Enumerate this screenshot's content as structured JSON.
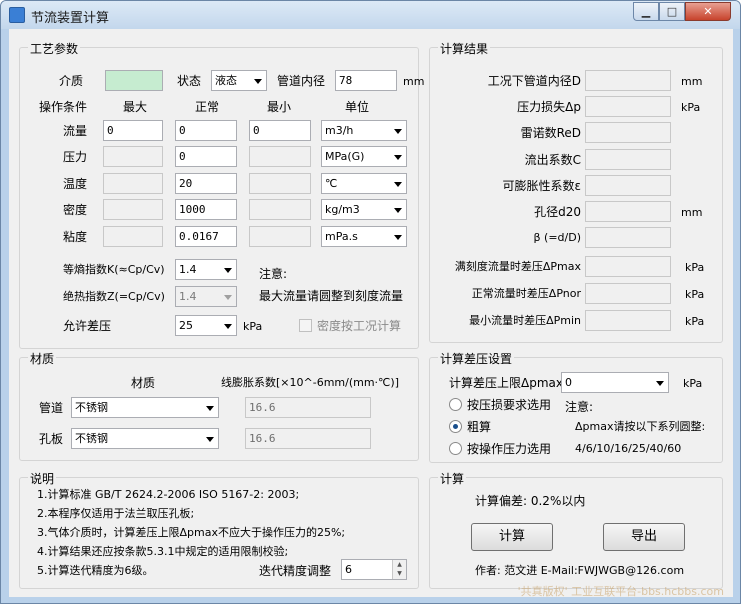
{
  "window": {
    "title": "节流装置计算",
    "min": "▁",
    "max": "□",
    "close": "✕"
  },
  "process": {
    "title": "工艺参数",
    "medium_label": "介质",
    "state_label": "状态",
    "state_value": "液态",
    "pipe_dia_label": "管道内径",
    "pipe_dia_value": "78",
    "pipe_dia_unit": "mm",
    "headers": {
      "cond": "操作条件",
      "max": "最大",
      "normal": "正常",
      "min": "最小",
      "unit": "单位"
    },
    "rows": [
      {
        "label": "流量",
        "max": "0",
        "normal": "0",
        "min": "0",
        "unit": "m3/h"
      },
      {
        "label": "压力",
        "max": "",
        "normal": "0",
        "min": "",
        "unit": "MPa(G)"
      },
      {
        "label": "温度",
        "max": "",
        "normal": "20",
        "min": "",
        "unit": "℃"
      },
      {
        "label": "密度",
        "max": "",
        "normal": "1000",
        "min": "",
        "unit": "kg/m3"
      },
      {
        "label": "粘度",
        "max": "",
        "normal": "0.0167",
        "min": "",
        "unit": "mPa.s"
      }
    ],
    "isen_label": "等熵指数K(≈Cp/Cv)",
    "isen_value": "1.4",
    "adiab_label": "绝热指数Z(=Cp/Cv)",
    "adiab_value": "1.4",
    "allow_label": "允许差压",
    "allow_value": "25",
    "allow_unit": "kPa",
    "note_title": "注意:",
    "note_text": "最大流量请圆整到刻度流量",
    "density_chk": "密度按工况计算"
  },
  "results": {
    "title": "计算结果",
    "rows": [
      {
        "label": "工况下管道内径D",
        "unit": "mm"
      },
      {
        "label": "压力损失Δp",
        "unit": "kPa"
      },
      {
        "label": "雷诺数ReD",
        "unit": ""
      },
      {
        "label": "流出系数C",
        "unit": ""
      },
      {
        "label": "可膨胀性系数ε",
        "unit": ""
      },
      {
        "label": "孔径d20",
        "unit": "mm"
      },
      {
        "label": "β (=d/D)",
        "unit": ""
      },
      {
        "label": "满刻度流量时差压ΔPmax",
        "unit": "kPa"
      },
      {
        "label": "正常流量时差压ΔPnor",
        "unit": "kPa"
      },
      {
        "label": "最小流量时差压ΔPmin",
        "unit": "kPa"
      }
    ]
  },
  "material": {
    "title": "材质",
    "col_mat": "材质",
    "col_coef": "线膨胀系数[×10^-6mm/(mm·℃)]",
    "pipe_label": "管道",
    "pipe_value": "不锈钢",
    "pipe_coef": "16.6",
    "orifice_label": "孔板",
    "orifice_value": "不锈钢",
    "orifice_coef": "16.6"
  },
  "dp_settings": {
    "title": "计算差压设置",
    "upper_label": "计算差压上限Δpmax",
    "upper_value": "0",
    "upper_unit": "kPa",
    "opt1": "按压损要求选用",
    "opt2": "粗算",
    "opt3": "按操作压力选用",
    "note_title": "注意:",
    "note_text": "Δpmax请按以下系列圆整:",
    "series": "4/6/10/16/25/40/60"
  },
  "explain": {
    "title": "说明",
    "lines": [
      "1.计算标准 GB/T 2624.2-2006 ISO 5167-2: 2003;",
      "2.本程序仅适用于法兰取压孔板;",
      "3.气体介质时，计算差压上限Δpmax不应大于操作压力的25%;",
      "4.计算结果还应按条款5.3.1中规定的适用限制校验;",
      "5.计算迭代精度为6级。"
    ],
    "iter_label": "迭代精度调整",
    "iter_value": "6"
  },
  "calc": {
    "title": "计算",
    "dev_text": "计算偏差: 0.2%以内",
    "calc_btn": "计算",
    "export_btn": "导出",
    "author": "作者: 范文进  E-Mail:FWJWGB@126.com"
  },
  "watermark": "'共真版权' 工业互联平台-bbs.hcbbs.com"
}
